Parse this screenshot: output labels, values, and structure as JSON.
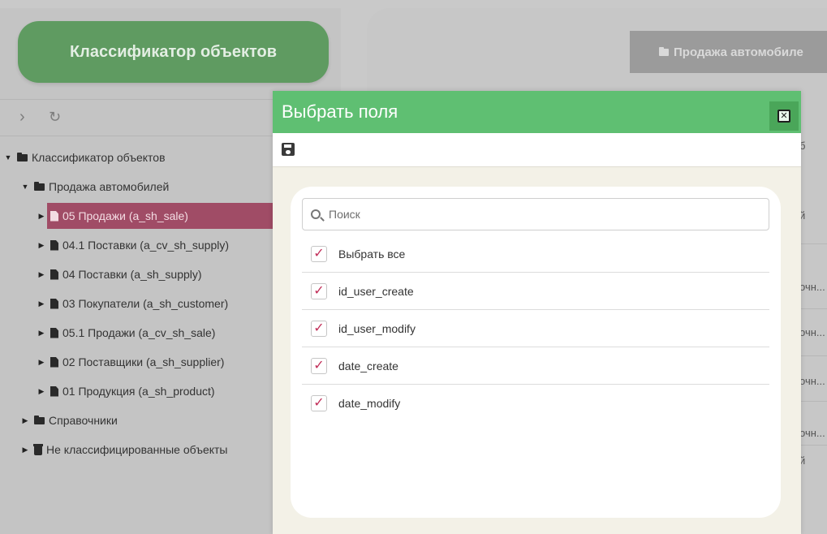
{
  "left": {
    "classifier_button": "Классификатор объектов",
    "tree": [
      {
        "label": "Классификатор объектов"
      },
      {
        "label": "Продажа автомобилей"
      },
      {
        "label": "05 Продажи (a_sh_sale)"
      },
      {
        "label": "04.1 Поставки (a_cv_sh_supply)"
      },
      {
        "label": "04 Поставки (a_sh_supply)"
      },
      {
        "label": "03 Покупатели (a_sh_customer)"
      },
      {
        "label": "05.1 Продажи (a_cv_sh_sale)"
      },
      {
        "label": "02 Поставщики (a_sh_supplier)"
      },
      {
        "label": "01 Продукция (a_sh_product)"
      },
      {
        "label": "Справочники"
      },
      {
        "label": "Не классифицированные объекты"
      }
    ]
  },
  "right": {
    "tab_label": "Продажа автомобиле",
    "fragments": [
      "б",
      "й",
      "очн...",
      "очн...",
      "очн...",
      "очн...",
      "й"
    ]
  },
  "modal": {
    "title": "Выбрать поля",
    "search_placeholder": "Поиск",
    "options": [
      {
        "label": "Выбрать все",
        "checked": true
      },
      {
        "label": "id_user_create",
        "checked": true
      },
      {
        "label": "id_user_modify",
        "checked": true
      },
      {
        "label": "date_create",
        "checked": true
      },
      {
        "label": "date_modify",
        "checked": true
      }
    ]
  },
  "colors": {
    "modal_header": "#5fbf72",
    "selected_row": "#a04c66",
    "checkmark": "#c2305a",
    "classifier_button": "#5f9b61"
  },
  "icons": {
    "collapse_arrow": "chevron-right-icon",
    "refresh": "refresh-icon",
    "folder": "folder-icon",
    "document": "file-icon",
    "table_document": "table-file-icon",
    "trash": "trash-icon",
    "save": "save-icon",
    "close": "close-icon",
    "search": "search-icon"
  }
}
